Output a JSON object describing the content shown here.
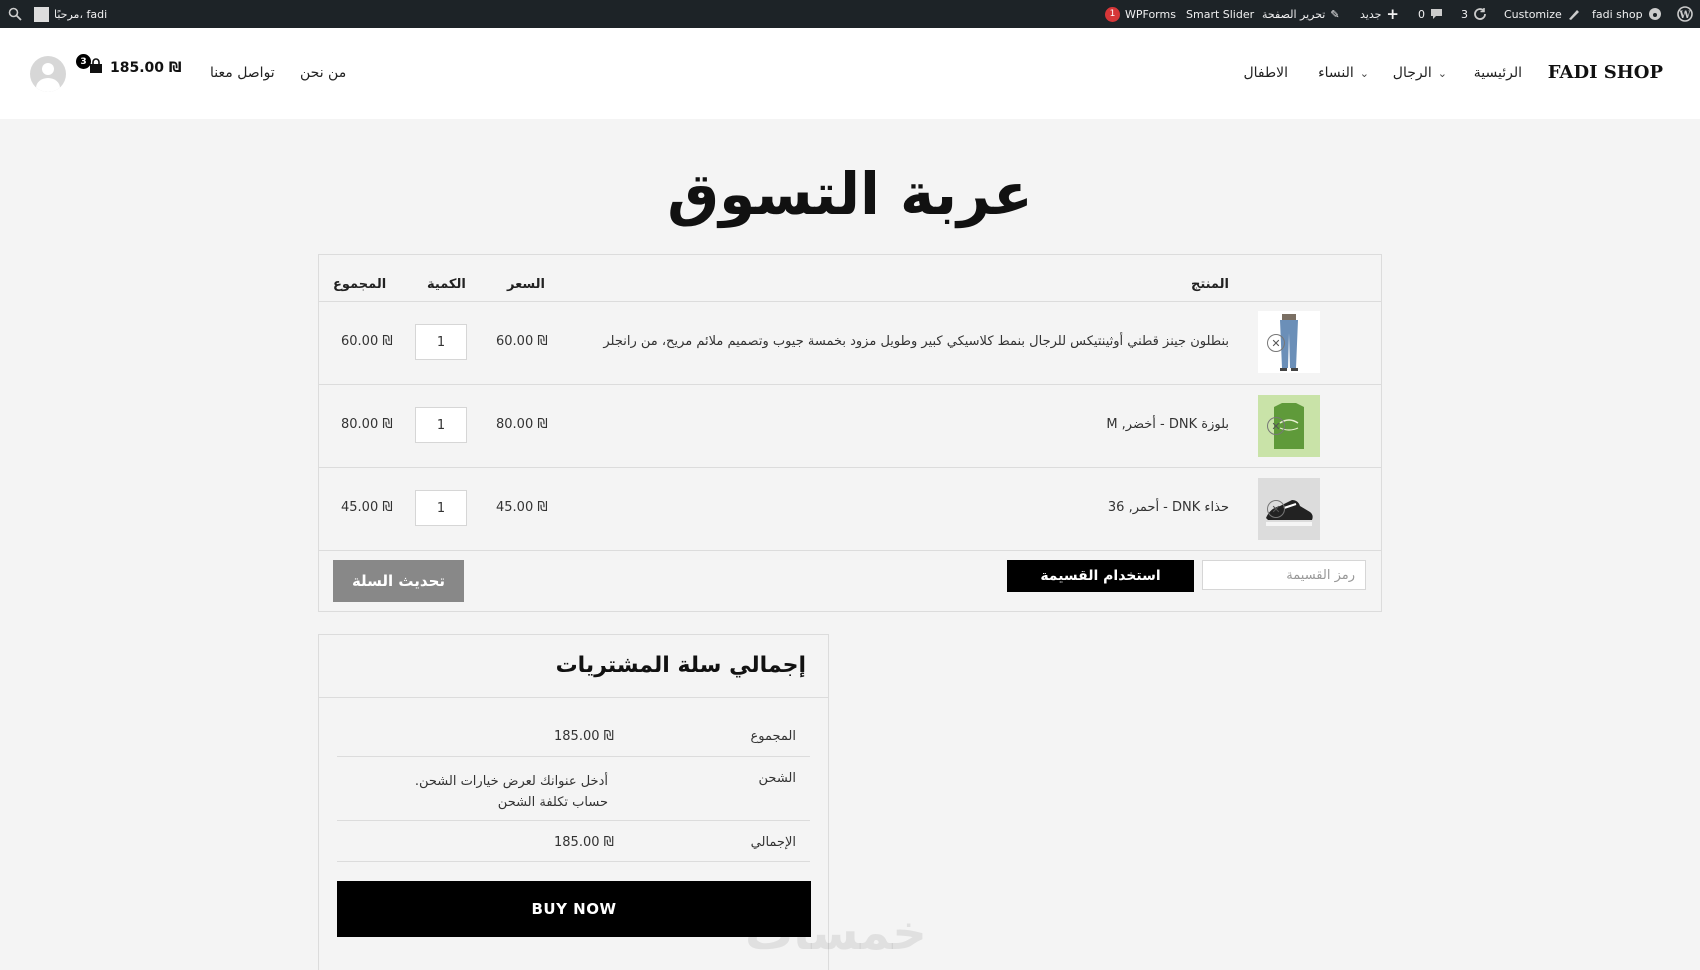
{
  "adminbar": {
    "site": "fadi shop",
    "customize": "Customize",
    "updates": "3",
    "comments": "0",
    "new": "جديد",
    "edit_page": "تحرير الصفحة",
    "smart_slider": "Smart Slider",
    "wpforms": "WPForms",
    "wpforms_badge": "1",
    "greeting": "مرحبًا، fadi"
  },
  "header": {
    "brand": "FADI SHOP",
    "nav": [
      "الرئيسية",
      "الرجال",
      "النساء",
      "الاطفال"
    ],
    "links": [
      "من نحن",
      "تواصل معنا"
    ],
    "cart_total": "185.00 ₪",
    "cart_count": "3"
  },
  "page": {
    "title": "عربة التسوق"
  },
  "cart": {
    "headers": {
      "product": "المنتج",
      "price": "السعر",
      "quantity": "الكمية",
      "subtotal": "المجموع"
    },
    "items": [
      {
        "name": "بنطلون جينز قطني أوثينتيكس للرجال بنمط كلاسيكي كبير وطويل مزود بخمسة جيوب وتصميم ملائم مريح، من رانجلر",
        "price": "60.00 ₪",
        "qty": "1",
        "subtotal": "60.00 ₪"
      },
      {
        "name": "بلوزة DNK - أخضر, M",
        "price": "80.00 ₪",
        "qty": "1",
        "subtotal": "80.00 ₪"
      },
      {
        "name": "حذاء DNK - أحمر, 36",
        "price": "45.00 ₪",
        "qty": "1",
        "subtotal": "45.00 ₪"
      }
    ],
    "coupon_placeholder": "رمز القسيمة",
    "apply_coupon": "استخدام القسيمة",
    "update_cart": "تحديث السلة"
  },
  "totals": {
    "title": "إجمالي سلة المشتريات",
    "subtotal_label": "المجموع",
    "subtotal_value": "185.00 ₪",
    "shipping_label": "الشحن",
    "shipping_line1": "أدخل عنوانك لعرض خيارات الشحن.",
    "shipping_line2": "حساب تكلفة الشحن",
    "total_label": "الإجمالي",
    "total_value": "185.00 ₪",
    "buy_now": "BUY NOW"
  },
  "watermark": "خمسات"
}
